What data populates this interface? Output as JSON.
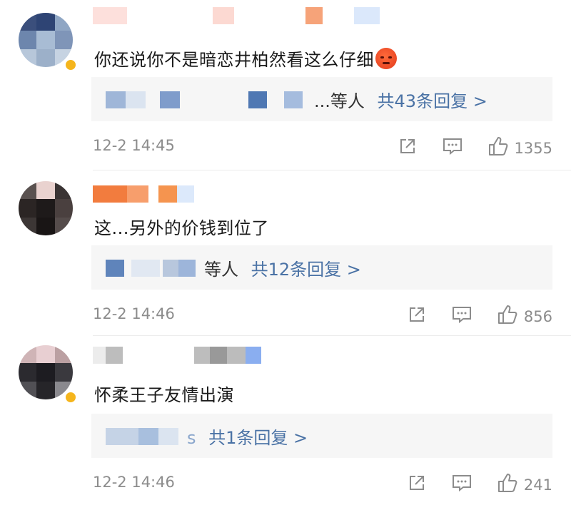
{
  "comments": [
    {
      "text": "你还说你不是暗恋井柏然看这么仔细",
      "emoji": "angry-face-icon",
      "reply_who": "...等人",
      "reply_total": "共43条回复 >",
      "time": "12-2 14:45",
      "likes": "1355"
    },
    {
      "text": "这...另外的价钱到位了",
      "reply_who": "等人",
      "reply_total": "共12条回复 >",
      "time": "12-2 14:46",
      "likes": "856"
    },
    {
      "text": "怀柔王子友情出演",
      "reply_who": "s",
      "reply_total": "共1条回复 >",
      "time": "12-2 14:46",
      "likes": "241"
    }
  ],
  "colors": {
    "link": "#4a72a5",
    "meta": "#8c8c8c",
    "reply_bg": "#f6f6f6",
    "vip_badge": "#f5b51c"
  }
}
